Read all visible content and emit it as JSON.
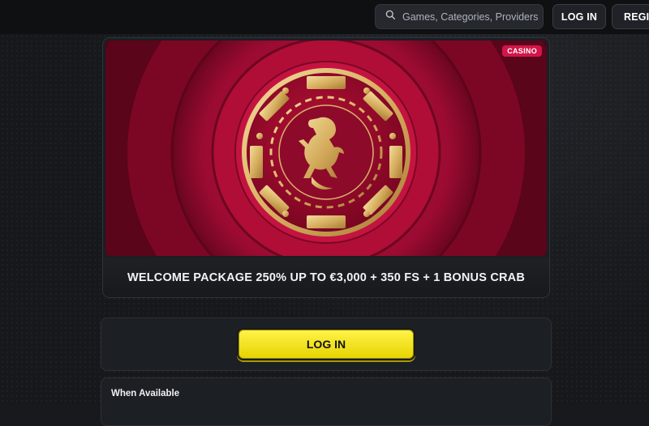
{
  "header": {
    "search": {
      "placeholder": "Games, Categories, Providers"
    },
    "login_label": "LOG IN",
    "register_label": "REGIS"
  },
  "promo": {
    "badge": "CASINO",
    "title": "WELCOME PACKAGE 250% UP TO €3,000 + 350 FS + 1 BONUS CRAB"
  },
  "login_panel": {
    "cta_label": "LOG IN"
  },
  "availability": {
    "title": "When Available"
  },
  "colors": {
    "accent_yellow": "#f5e51c",
    "badge_red": "#d3154a",
    "banner_red": "#a00a30",
    "chip_gold": "#e2c27a"
  },
  "icons": {
    "search": "search-icon",
    "lion": "lion-emblem-icon"
  }
}
